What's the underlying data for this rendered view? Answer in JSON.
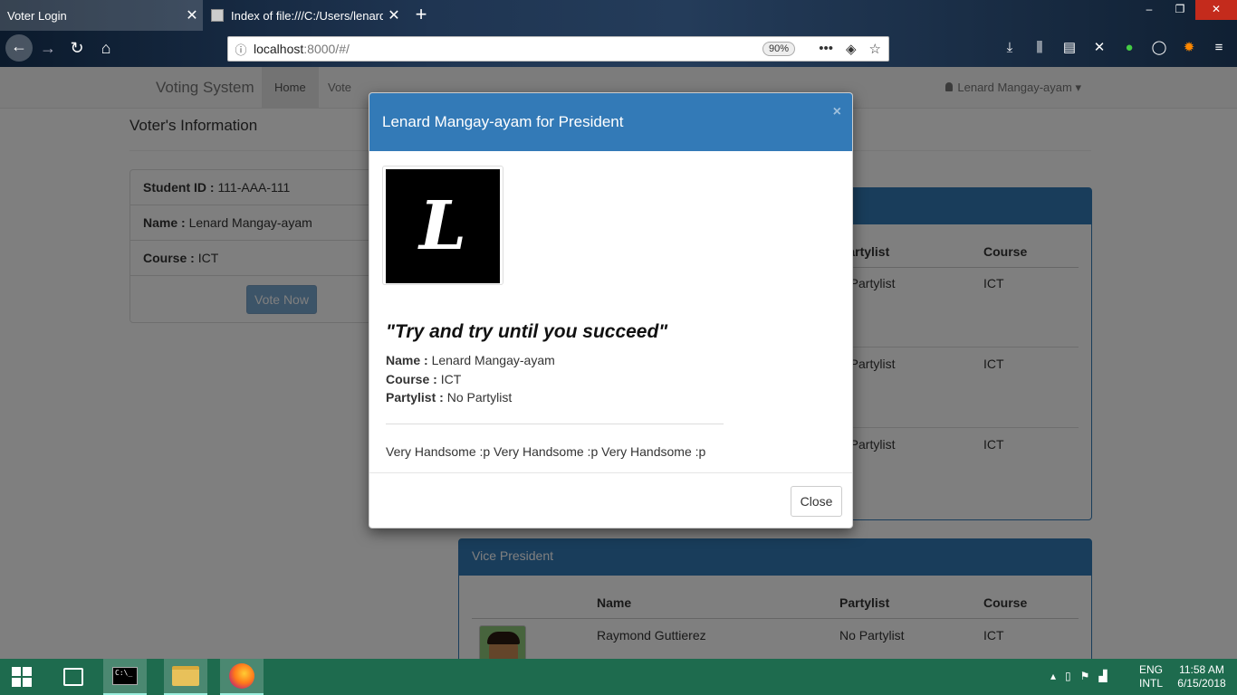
{
  "browser": {
    "tabs": [
      {
        "title": "Voter Login",
        "active": true
      },
      {
        "title": "Index of file:///C:/Users/lenard",
        "active": false
      }
    ],
    "url_host": "localhost",
    "url_path": ":8000/#/",
    "zoom": "90%"
  },
  "navbar": {
    "brand": "Voting System",
    "links": [
      "Home",
      "Vote"
    ],
    "user": "Lenard Mangay-ayam"
  },
  "voter_info": {
    "title": "Voter's Information",
    "student_id_label": "Student ID :",
    "student_id": "111-AAA-111",
    "name_label": "Name :",
    "name": "Lenard Mangay-ayam",
    "course_label": "Course :",
    "course": "ICT",
    "vote_button": "Vote Now"
  },
  "president_table": {
    "headers": [
      "Partylist",
      "Course"
    ],
    "rows": [
      {
        "partylist": "o Partylist",
        "course": "ICT"
      },
      {
        "partylist": "o Partylist",
        "course": "ICT"
      },
      {
        "partylist": "o Partylist",
        "course": "ICT"
      }
    ]
  },
  "vice_president": {
    "title": "Vice President",
    "headers": [
      "Name",
      "Partylist",
      "Course"
    ],
    "rows": [
      {
        "name": "Raymond Guttierez",
        "partylist": "No Partylist",
        "course": "ICT"
      }
    ]
  },
  "modal": {
    "title": "Lenard Mangay-ayam for President",
    "close_x": "×",
    "logo_letter": "L",
    "motto": "\"Try and try until you succeed\"",
    "name_label": "Name :",
    "name": "Lenard Mangay-ayam",
    "course_label": "Course :",
    "course": "ICT",
    "partylist_label": "Partylist :",
    "partylist": "No Partylist",
    "description": "Very Handsome :p Very Handsome :p Very Handsome :p",
    "close_button": "Close"
  },
  "taskbar": {
    "lang_top": "ENG",
    "lang_bottom": "INTL",
    "time": "11:58 AM",
    "date": "6/15/2018"
  },
  "colors": {
    "primary": "#337ab7",
    "taskbar": "#1e6b4e"
  }
}
